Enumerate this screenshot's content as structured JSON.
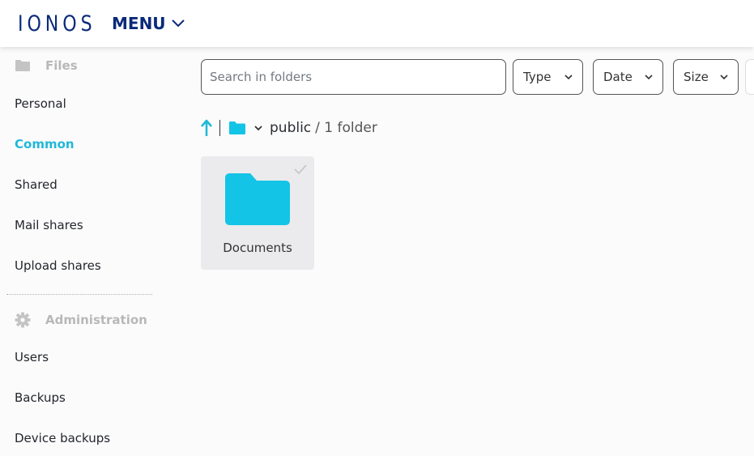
{
  "header": {
    "logo": "IONOS",
    "menu_label": "MENU"
  },
  "sidebar": {
    "files_heading": "Files",
    "file_items": [
      {
        "label": "Personal",
        "active": false
      },
      {
        "label": "Common",
        "active": true
      },
      {
        "label": "Shared",
        "active": false
      },
      {
        "label": "Mail shares",
        "active": false
      },
      {
        "label": "Upload shares",
        "active": false
      }
    ],
    "admin_heading": "Administration",
    "admin_items": [
      {
        "label": "Users"
      },
      {
        "label": "Backups"
      },
      {
        "label": "Device backups"
      }
    ]
  },
  "toolbar": {
    "search_placeholder": "Search in folders",
    "search_value": "",
    "filters": [
      {
        "label": "Type"
      },
      {
        "label": "Date"
      },
      {
        "label": "Size"
      }
    ]
  },
  "breadcrumb": {
    "current": "public",
    "summary": "/ 1 folder"
  },
  "items": [
    {
      "name": "Documents",
      "type": "folder"
    }
  ],
  "colors": {
    "brand": "#0b2a7a",
    "accent": "#22b8d8",
    "folder": "#13c4e6"
  }
}
